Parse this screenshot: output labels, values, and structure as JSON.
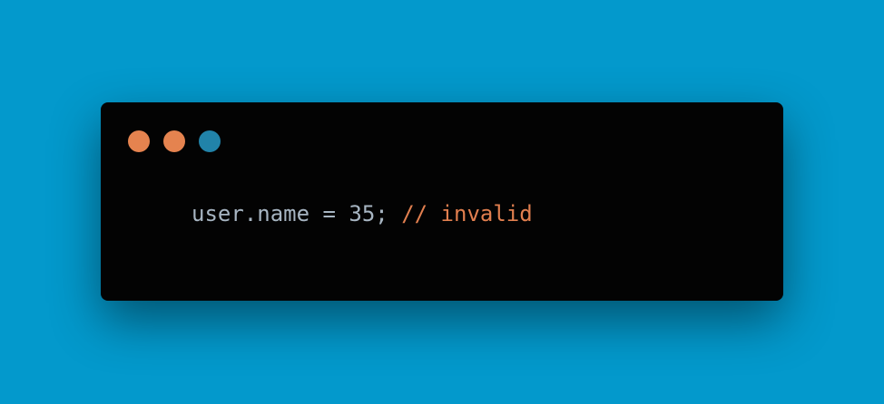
{
  "window": {
    "controls": [
      {
        "icon": "close-dot-icon",
        "color": "#e5834f"
      },
      {
        "icon": "minimize-dot-icon",
        "color": "#e5834f"
      },
      {
        "icon": "maximize-dot-icon",
        "color": "#2183a9"
      }
    ]
  },
  "code": {
    "statement": "user.name = 35;",
    "comment": "// invalid"
  },
  "colors": {
    "background": "#0399cc",
    "window": "#030303",
    "code_text": "#a7b5c2",
    "comment_text": "#e17f4f"
  }
}
